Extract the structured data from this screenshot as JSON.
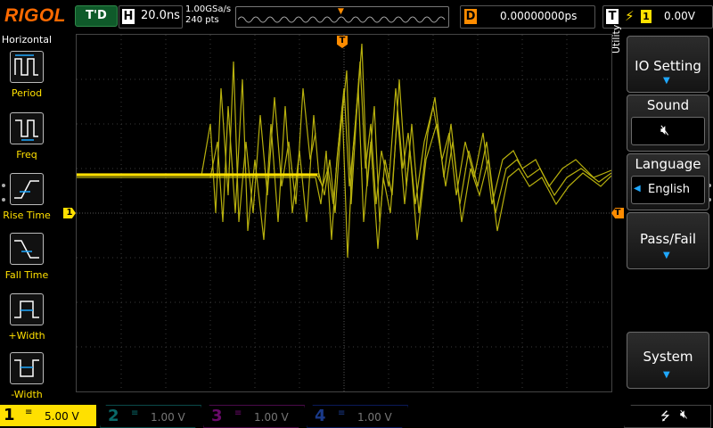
{
  "topbar": {
    "logo": "RIGOL",
    "trigger_status": "T'D",
    "horizontal_label": "H",
    "timebase": "20.0ns",
    "sample_rate": "1.00GSa/s",
    "memory_depth": "240  pts",
    "delay_label": "D",
    "delay_value": "0.00000000ps",
    "trigger_label": "T",
    "trigger_source": "1",
    "trigger_level": "0.00V"
  },
  "left_menu": {
    "title": "Horizontal",
    "items": [
      {
        "label": "Period",
        "icon": "period-icon"
      },
      {
        "label": "Freq",
        "icon": "frequency-icon"
      },
      {
        "label": "Rise Time",
        "icon": "rise-time-icon"
      },
      {
        "label": "Fall Time",
        "icon": "fall-time-icon"
      },
      {
        "label": "+Width",
        "icon": "positive-width-icon"
      },
      {
        "label": "-Width",
        "icon": "negative-width-icon"
      }
    ]
  },
  "right_menu": {
    "side_label": "Utility",
    "io_setting": "IO Setting",
    "sound": "Sound",
    "language": "Language",
    "language_value": "English",
    "pass_fail": "Pass/Fail",
    "system": "System"
  },
  "markers": {
    "trigger_pos": "T",
    "ch1_marker": "1",
    "trig_level_marker": "T"
  },
  "channels": [
    {
      "num": "1",
      "coupling": "≡",
      "scale": "5.00 V",
      "color": "#ffe000",
      "active": true
    },
    {
      "num": "2",
      "coupling": "≡",
      "scale": "1.00 V",
      "color": "#00b0b0",
      "active": false
    },
    {
      "num": "3",
      "coupling": "≡",
      "scale": "1.00 V",
      "color": "#d000d0",
      "active": false
    },
    {
      "num": "4",
      "coupling": "≡",
      "scale": "1.00 V",
      "color": "#2060ff",
      "active": false
    }
  ],
  "status_icons": [
    "usb-icon",
    "mute-icon"
  ],
  "colors": {
    "accent": "#ff8c00",
    "ch1": "#ffe000",
    "menu_arrow": "#1fa8ff"
  }
}
